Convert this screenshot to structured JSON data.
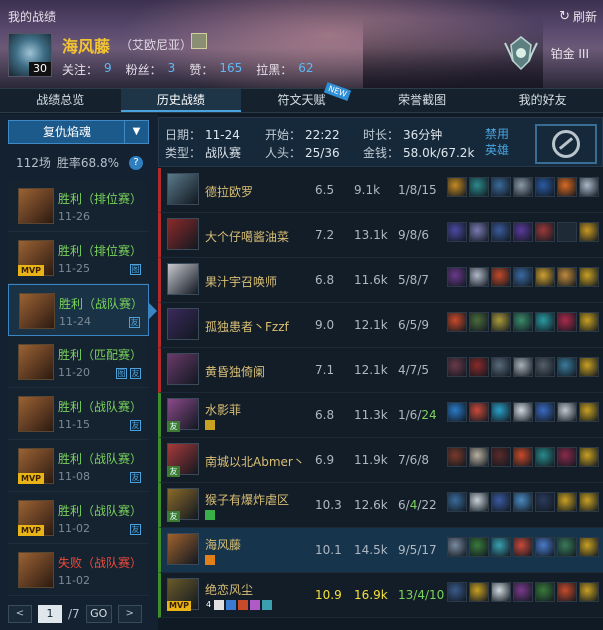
{
  "window": {
    "title": "我的战绩",
    "refresh_label": "刷新"
  },
  "player": {
    "name": "海风藤",
    "server": "（艾欧尼亚）",
    "level": "30",
    "follow_label": "关注：",
    "follow": "9",
    "fans_label": "粉丝：",
    "fans": "3",
    "likes_label": "赞：",
    "likes": "165",
    "dislikes_label": "拉黑：",
    "dislikes": "62",
    "tier": "铂金 III"
  },
  "tabs": [
    {
      "label": "战绩总览"
    },
    {
      "label": "历史战绩"
    },
    {
      "label": "符文天赋",
      "badge": "NEW"
    },
    {
      "label": "荣誉截图"
    },
    {
      "label": "我的好友"
    }
  ],
  "left": {
    "mode": "复仇焰魂",
    "summary_games": "112场",
    "summary_winrate": "胜率68.8%",
    "matches": [
      {
        "result": "胜利（排位赛）",
        "date": "11-26",
        "mvp": false,
        "win": true,
        "badges": []
      },
      {
        "result": "胜利（排位赛）",
        "date": "11-25",
        "mvp": true,
        "win": true,
        "badges": [
          "图"
        ]
      },
      {
        "result": "胜利（战队赛）",
        "date": "11-24",
        "mvp": false,
        "win": true,
        "badges": [
          "友"
        ]
      },
      {
        "result": "胜利（匹配赛）",
        "date": "11-20",
        "mvp": false,
        "win": true,
        "badges": [
          "图",
          "友"
        ]
      },
      {
        "result": "胜利（战队赛）",
        "date": "11-15",
        "mvp": false,
        "win": true,
        "badges": [
          "友"
        ]
      },
      {
        "result": "胜利（战队赛）",
        "date": "11-08",
        "mvp": true,
        "win": true,
        "badges": [
          "友"
        ]
      },
      {
        "result": "胜利（战队赛）",
        "date": "11-02",
        "mvp": true,
        "win": true,
        "badges": [
          "友"
        ]
      },
      {
        "result": "失败（战队赛）",
        "date": "11-02",
        "mvp": false,
        "win": false,
        "badges": []
      }
    ],
    "pager": {
      "current": "1",
      "total": "/7",
      "go": "GO"
    }
  },
  "detail": {
    "date_label": "日期：",
    "date": "11-24",
    "type_label": "类型：",
    "type": "战队赛",
    "start_label": "开始：",
    "start": "22:22",
    "kills_label": "人头：",
    "kills": "25/36",
    "duration_label": "时长：",
    "duration": "36分钟",
    "gold_label": "金钱：",
    "gold": "58.0k/67.2k",
    "ban_label": "禁用英雄"
  },
  "players": [
    {
      "team": "red",
      "name": "德拉欧罗",
      "score": "6.5",
      "gold": "9.1k",
      "kda": "1/8/15",
      "portrait": "#5a7a8a",
      "items": [
        "#c48a22",
        "#2c8a8a",
        "#3a6a9a",
        "#8a9aa8",
        "#2a5aa0",
        "#d86a22",
        "#aab8c8"
      ]
    },
    {
      "team": "red",
      "name": "大个仔噶酱油菜",
      "score": "7.2",
      "gold": "13.1k",
      "kda": "9/8/6",
      "portrait": "#8a2a2a",
      "items": [
        "#4a4aa0",
        "#7a7ab0",
        "#3a5a9a",
        "#5a3a9a",
        "#9a3a3a",
        "empty",
        "#c89a22"
      ]
    },
    {
      "team": "red",
      "name": "果汁宇召唤师",
      "score": "6.8",
      "gold": "11.6k",
      "kda": "5/8/7",
      "portrait": "#c8c8d0",
      "items": [
        "#6a3a8a",
        "#b0b8c8",
        "#c04a2a",
        "#3a6aa0",
        "#d0a030",
        "#c08a3a",
        "#c8a022"
      ]
    },
    {
      "team": "red",
      "name": "孤独患者丶Fzzf",
      "score": "9.0",
      "gold": "12.1k",
      "kda": "6/5/9",
      "portrait": "#3a2a5a",
      "items": [
        "#c84a2a",
        "#4a6a3a",
        "#aa9a3a",
        "#3a8a6a",
        "#2a9aa0",
        "#aa2a4a",
        "#c8a022"
      ]
    },
    {
      "team": "red",
      "name": "黄昏独倚阑",
      "score": "7.1",
      "gold": "12.1k",
      "kda": "4/7/5",
      "portrait": "#6a3a6a",
      "items": [
        "#6a3a4a",
        "#8a2a2a",
        "#5a6a7a",
        "#a8b0b8",
        "#555f6a",
        "#3a7a9a",
        "#c8a022"
      ]
    },
    {
      "team": "blue",
      "name": "水影菲",
      "score": "6.8",
      "gold": "11.3k",
      "kda": "1/6/",
      "kda_a": "24",
      "portrait": "#8a4a8a",
      "rank_small": "友",
      "tags": [
        "#c8a022"
      ],
      "items": [
        "#2a7ac8",
        "#c84a3a",
        "#2aa0c8",
        "#d0d8e0",
        "#3a6ac0",
        "#c0c8d0",
        "#c8a022"
      ]
    },
    {
      "team": "blue",
      "name": "南城以北Abmer丶",
      "score": "6.9",
      "gold": "11.9k",
      "kda": "7/6/8",
      "portrait": "#a83a3a",
      "rank_small": "友",
      "items": [
        "#7a3a2a",
        "#b8b0a0",
        "#5a2a2a",
        "#c84a2a",
        "#2a8a8a",
        "#8a2a4a",
        "#c8a022"
      ]
    },
    {
      "team": "blue",
      "name": "猴子有爆炸虐区",
      "score": "10.3",
      "gold": "12.6k",
      "kda": "6/",
      "kda_mid": "4",
      "kda_end": "/22",
      "portrait": "#8a6a2a",
      "rank_small": "友",
      "tags": [
        "#3ab04a"
      ],
      "items": [
        "#3a6a9a",
        "#c8d0d8",
        "#3a5aa0",
        "#4a8ac0",
        "#2a3a5a",
        "#c8a022",
        "#c8a022"
      ]
    },
    {
      "team": "blue",
      "me": true,
      "name": "海风藤",
      "score": "10.1",
      "gold": "14.5k",
      "kda": "9/5/17",
      "portrait": "#a0622e",
      "tags": [
        "#e0801a"
      ],
      "items": [
        "#7a8aa0",
        "#3a7a3a",
        "#3aa0b0",
        "#c84a3a",
        "#4a7ac8",
        "#3a7a5a",
        "#c8a022"
      ]
    },
    {
      "team": "blue",
      "hi": true,
      "name": "绝恋风尘",
      "score": "10.9",
      "gold": "16.9k",
      "kda": "13/4/10",
      "portrait": "#6a5a2a",
      "mvp": "MVP",
      "tags": [
        "#e0e0e0",
        "#3a7ad0",
        "#c84a2a",
        "#b05ac8",
        "#3aa0b0"
      ],
      "tag_num": "4",
      "items": [
        "#3a5a8a",
        "#c8a022",
        "#d0d8e0",
        "#7a3a8a",
        "#3a7a3a",
        "#c84a2a",
        "#c8a022"
      ]
    }
  ]
}
